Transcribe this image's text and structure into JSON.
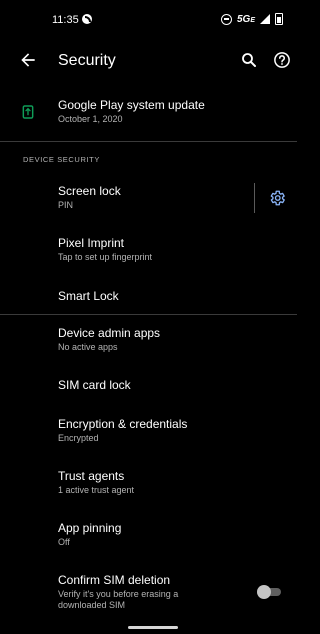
{
  "status_bar": {
    "time": "11:35",
    "network": "5G",
    "network_suffix": "E"
  },
  "app_bar": {
    "title": "Security"
  },
  "items": {
    "play_update": {
      "title": "Google Play system update",
      "subtitle": "October 1, 2020"
    },
    "section_device_security": "DEVICE SECURITY",
    "screen_lock": {
      "title": "Screen lock",
      "subtitle": "PIN"
    },
    "pixel_imprint": {
      "title": "Pixel Imprint",
      "subtitle": "Tap to set up fingerprint"
    },
    "smart_lock": {
      "title": "Smart Lock"
    },
    "device_admin": {
      "title": "Device admin apps",
      "subtitle": "No active apps"
    },
    "sim_lock": {
      "title": "SIM card lock"
    },
    "encryption": {
      "title": "Encryption & credentials",
      "subtitle": "Encrypted"
    },
    "trust_agents": {
      "title": "Trust agents",
      "subtitle": "1 active trust agent"
    },
    "app_pinning": {
      "title": "App pinning",
      "subtitle": "Off"
    },
    "confirm_sim": {
      "title": "Confirm SIM deletion",
      "subtitle_line1": "Verify it's you before erasing a",
      "subtitle_line2": "downloaded SIM",
      "toggle_on": false
    }
  },
  "colors": {
    "background": "#000000",
    "accent": "#8ab4f8",
    "play_icon": "#0f9d58"
  }
}
